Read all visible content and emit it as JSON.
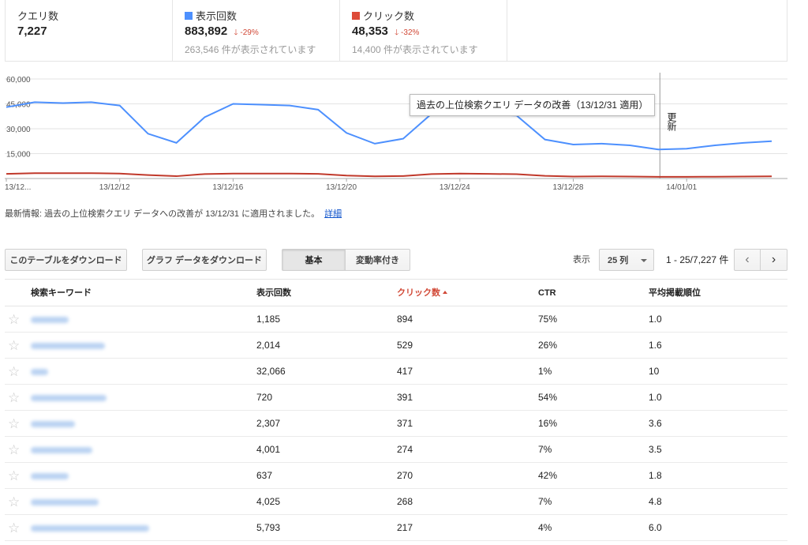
{
  "summary": {
    "queries": {
      "label": "クエリ数",
      "value": "7,227"
    },
    "impressions": {
      "label": "表示回数",
      "value": "883,892",
      "delta": "-29%",
      "sub": "263,546 件が表示されています",
      "color": "#4d90fe"
    },
    "clicks": {
      "label": "クリック数",
      "value": "48,353",
      "delta": "-32%",
      "sub": "14,400 件が表示されています",
      "color": "#dd4b39"
    }
  },
  "chart_data": {
    "type": "line",
    "x": [
      "13/12/08",
      "13/12/09",
      "13/12/10",
      "13/12/11",
      "13/12/12",
      "13/12/13",
      "13/12/14",
      "13/12/15",
      "13/12/16",
      "13/12/17",
      "13/12/18",
      "13/12/19",
      "13/12/20",
      "13/12/21",
      "13/12/22",
      "13/12/23",
      "13/12/24",
      "13/12/25",
      "13/12/26",
      "13/12/27",
      "13/12/28",
      "13/12/29",
      "13/12/30",
      "13/12/31",
      "14/01/01",
      "14/01/02",
      "14/01/03",
      "14/01/04"
    ],
    "x_tick_labels": [
      "13/12...",
      "13/12/12",
      "13/12/16",
      "13/12/20",
      "13/12/24",
      "13/12/28",
      "14/01/01"
    ],
    "y_tick_labels": [
      "60,000",
      "45,000",
      "30,000",
      "15,000"
    ],
    "ylim": [
      0,
      60000
    ],
    "grid": true,
    "series": [
      {
        "name": "表示回数",
        "color": "#4d90fe",
        "values": [
          43000,
          46000,
          45500,
          46000,
          44000,
          27000,
          21500,
          37000,
          45000,
          44500,
          44000,
          41500,
          27500,
          21000,
          24000,
          39000,
          40500,
          38500,
          38000,
          23500,
          20500,
          21000,
          20000,
          17500,
          18000,
          20000,
          21500,
          22500
        ]
      },
      {
        "name": "クリック数",
        "color": "#c0392b",
        "values": [
          2800,
          3200,
          3200,
          3200,
          3000,
          2100,
          1400,
          2700,
          3000,
          3000,
          3000,
          2800,
          1800,
          1300,
          1500,
          2700,
          3000,
          2800,
          2600,
          1600,
          1200,
          1300,
          1200,
          1000,
          1000,
          1100,
          1200,
          1300
        ]
      }
    ],
    "annotation_index": 23,
    "annotation_label": "更新",
    "tooltip": "過去の上位検索クエリ データの改善（13/12/31 適用）"
  },
  "news": {
    "text": "最新情報: 過去の上位検索クエリ データへの改善が 13/12/31 に適用されました。",
    "link": "詳細"
  },
  "toolbar": {
    "download_table": "このテーブルをダウンロード",
    "download_chart": "グラフ データをダウンロード",
    "tab_basic": "基本",
    "tab_change": "変動率付き",
    "show_label": "表示",
    "rows_select": "25 列",
    "pager": "1 - 25/7,227 件",
    "prev": "‹",
    "next": "›"
  },
  "table": {
    "headers": {
      "keyword": "検索キーワード",
      "impressions": "表示回数",
      "clicks": "クリック数",
      "ctr": "CTR",
      "position": "平均掲載順位"
    },
    "rows": [
      {
        "impressions": "1,185",
        "clicks": "894",
        "ctr": "75%",
        "position": "1.0",
        "kw_w": 48
      },
      {
        "impressions": "2,014",
        "clicks": "529",
        "ctr": "26%",
        "position": "1.6",
        "kw_w": 94
      },
      {
        "impressions": "32,066",
        "clicks": "417",
        "ctr": "1%",
        "position": "10",
        "kw_w": 22
      },
      {
        "impressions": "720",
        "clicks": "391",
        "ctr": "54%",
        "position": "1.0",
        "kw_w": 96
      },
      {
        "impressions": "2,307",
        "clicks": "371",
        "ctr": "16%",
        "position": "3.6",
        "kw_w": 56
      },
      {
        "impressions": "4,001",
        "clicks": "274",
        "ctr": "7%",
        "position": "3.5",
        "kw_w": 78
      },
      {
        "impressions": "637",
        "clicks": "270",
        "ctr": "42%",
        "position": "1.8",
        "kw_w": 48
      },
      {
        "impressions": "4,025",
        "clicks": "268",
        "ctr": "7%",
        "position": "4.8",
        "kw_w": 86
      },
      {
        "impressions": "5,793",
        "clicks": "217",
        "ctr": "4%",
        "position": "6.0",
        "kw_w": 150
      }
    ]
  }
}
